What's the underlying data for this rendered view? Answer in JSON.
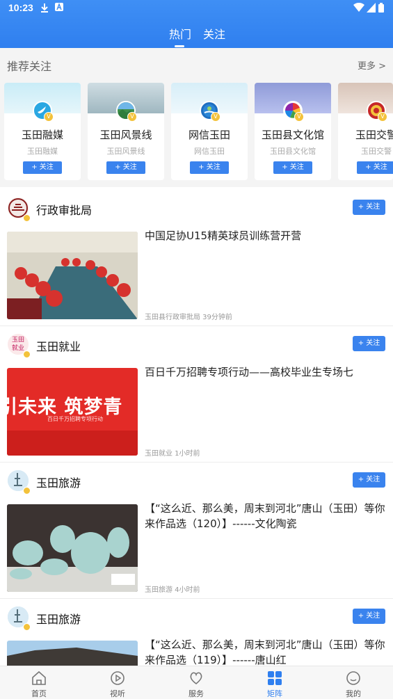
{
  "status_bar": {
    "time": "10:23"
  },
  "top_tabs": [
    {
      "label": "热门"
    },
    {
      "label": "关注"
    }
  ],
  "recommend": {
    "title": "推荐关注",
    "more": "更多 >",
    "cards": [
      {
        "name": "玉田融媒",
        "sub": "玉田融媒",
        "follow": "+ 关注"
      },
      {
        "name": "玉田风景线",
        "sub": "玉田风景线",
        "follow": "+ 关注"
      },
      {
        "name": "网信玉田",
        "sub": "网信玉田",
        "follow": "+ 关注"
      },
      {
        "name": "玉田县文化馆",
        "sub": "玉田县文化馆",
        "follow": "+ 关注"
      },
      {
        "name": "玉田交警",
        "sub": "玉田交警",
        "follow": "+ 关注"
      }
    ]
  },
  "feed": [
    {
      "account": "行政审批局",
      "follow": "+ 关注",
      "title": "中国足协U15精英球员训练营开营",
      "meta": "玉田县行政审批局   39分钟前"
    },
    {
      "account": "玉田就业",
      "follow": "+ 关注",
      "title": "百日千万招聘专项行动——高校毕业生专场七",
      "meta": "玉田就业   1小时前",
      "image_text": "引未来  筑梦青",
      "image_subtext": "百日千万招聘专项行动",
      "avatar_text": "玉田就业"
    },
    {
      "account": "玉田旅游",
      "follow": "+ 关注",
      "title": "【“这么近、那么美，周末到河北”唐山（玉田）等你来作品选（120）】------文化陶瓷",
      "meta": "玉田旅游   4小时前"
    },
    {
      "account": "玉田旅游",
      "follow": "+ 关注",
      "title": "【“这么近、那么美，周末到河北”唐山（玉田）等你来作品选（119）】------唐山红",
      "meta": ""
    }
  ],
  "bottom_nav": [
    {
      "label": "首页",
      "icon": "home-icon",
      "active": false
    },
    {
      "label": "视听",
      "icon": "play-icon",
      "active": false
    },
    {
      "label": "服务",
      "icon": "service-heart-icon",
      "active": false
    },
    {
      "label": "矩阵",
      "icon": "matrix-grid-icon",
      "active": true
    },
    {
      "label": "我的",
      "icon": "profile-icon",
      "active": false
    }
  ],
  "colors": {
    "primary": "#3a83ee",
    "header": "#3a8af3",
    "badge": "#f3c23b"
  }
}
